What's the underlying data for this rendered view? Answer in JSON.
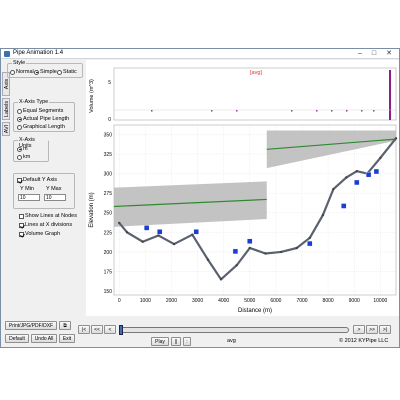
{
  "window": {
    "title": "Pipe Animation 1.4"
  },
  "side": {
    "tabs": [
      "Axis",
      "Labels",
      "AVI"
    ],
    "style": {
      "legend": "Style",
      "options": [
        "Normal",
        "Simple",
        "Static"
      ],
      "selected": "Simple"
    },
    "xaxis_type": {
      "legend": "X-Axis Type",
      "options": [
        "Equal Segments",
        "Actual Pipe Length",
        "Graphical Length"
      ],
      "selected": "Actual Pipe Length"
    },
    "xaxis_units": {
      "legend": "X-Axis Units",
      "options": [
        "m",
        "km"
      ],
      "selected": "m"
    },
    "default_y_axis": {
      "label": "Default Y Axis",
      "checked": true
    },
    "ymin_label": "Y Min",
    "ymax_label": "Y Max",
    "ymin_value": "10",
    "ymax_value": "10",
    "checks": [
      {
        "label": "Show Lines at Nodes",
        "checked": false
      },
      {
        "label": "Lines at X divisions",
        "checked": true
      },
      {
        "label": "Volume Graph",
        "checked": true
      }
    ],
    "print_button": "Print/JPG/PDF/DXF",
    "default_button": "Default",
    "undo_button": "Undo All",
    "exit_button": "Exit"
  },
  "chart_data": {
    "type": "line",
    "volume_panel": {
      "title": "[avg]",
      "ylabel": "Volume (m^3)",
      "y_ticks": [
        "5",
        "0"
      ],
      "title_color": "#e03030"
    },
    "main_panel": {
      "xlabel": "Distance (m)",
      "ylabel": "Elevation (m)",
      "x_ticks": [
        "0",
        "1000",
        "2000",
        "3000",
        "4000",
        "5000",
        "6000",
        "7000",
        "8000",
        "9000",
        "10000"
      ],
      "y_ticks": [
        "350",
        "325",
        "300",
        "275",
        "250",
        "225",
        "200",
        "175",
        "150"
      ],
      "xlim": [
        -200,
        10600
      ],
      "ylim": [
        145,
        362
      ],
      "profile": {
        "name": "Pipe elevation",
        "color": "#5a6270",
        "x": [
          0,
          300,
          900,
          1500,
          2100,
          2800,
          3400,
          3900,
          4500,
          5000,
          5600,
          6200,
          6800,
          7300,
          7800,
          8200,
          8700,
          9100,
          9500,
          10000,
          10600
        ],
        "y": [
          237,
          225,
          213,
          221,
          210,
          222,
          190,
          165,
          183,
          205,
          198,
          200,
          205,
          218,
          247,
          280,
          295,
          303,
          300,
          320,
          345
        ]
      },
      "hgl_segments": [
        {
          "x": [
            -200,
            5650
          ],
          "y": [
            258,
            267
          ],
          "band_top": [
            282,
            290
          ],
          "band_bottom": [
            232,
            242
          ]
        },
        {
          "x": [
            5650,
            10600
          ],
          "y": [
            331,
            344
          ],
          "band_top": [
            355,
            355
          ],
          "band_bottom": [
            307,
            342
          ]
        }
      ],
      "markers": [
        {
          "x": 1050,
          "y": 230
        },
        {
          "x": 1550,
          "y": 225
        },
        {
          "x": 2950,
          "y": 225
        },
        {
          "x": 4450,
          "y": 200
        },
        {
          "x": 5000,
          "y": 213
        },
        {
          "x": 7300,
          "y": 210
        },
        {
          "x": 8600,
          "y": 258
        },
        {
          "x": 9100,
          "y": 288
        },
        {
          "x": 9550,
          "y": 298
        },
        {
          "x": 9850,
          "y": 302
        }
      ]
    }
  },
  "bottom": {
    "nav_buttons": [
      "|<",
      "<<",
      "<",
      ">",
      ">>",
      ">|"
    ],
    "play_label": "Play",
    "pause_label": "||",
    "stop_label": ":",
    "avg_label": "avg",
    "copyright": "© 2012 KYPipe LLC"
  },
  "colors": {
    "accent": "#3a6fb0",
    "marker": "#1a3fd0",
    "hgl": "#2f8a2f",
    "band": "#b8b8b8",
    "volume_bar": "#8a1f8a"
  }
}
